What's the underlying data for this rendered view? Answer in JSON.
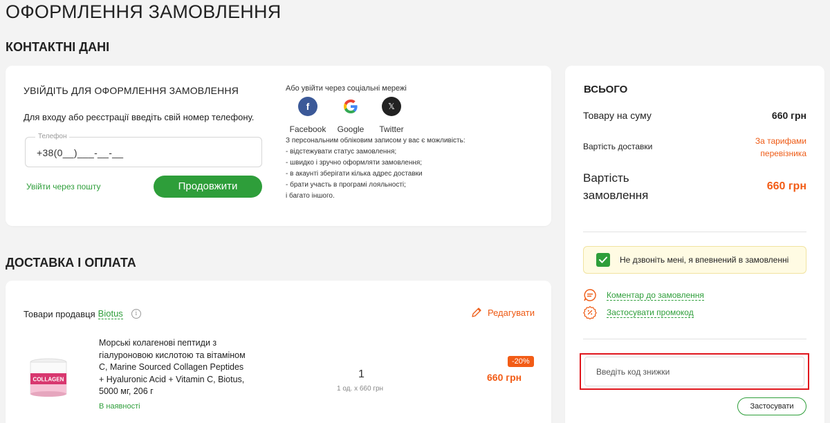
{
  "page": {
    "title": "ОФОРМЛЕННЯ ЗАМОВЛЕННЯ",
    "contacts_title": "КОНТАКТНІ ДАНІ",
    "delivery_title": "ДОСТАВКА І ОПЛАТА"
  },
  "login": {
    "heading": "УВІЙДІТЬ ДЛЯ ОФОРМЛЕННЯ ЗАМОВЛЕННЯ",
    "hint": "Для входу або реєстрації введіть свій номер телефону.",
    "phone_label": "Телефон",
    "phone_value": "+38(0__)___-__-__",
    "email_link": "Увійти через пошту",
    "continue_label": "Продовжити",
    "social_title": "Або увійти через соціальні мережі",
    "social": [
      {
        "name": "Facebook",
        "icon": "facebook-icon"
      },
      {
        "name": "Google",
        "icon": "google-icon"
      },
      {
        "name": "Twitter",
        "icon": "x-icon"
      }
    ],
    "benefits_intro": "З персональним обліковим записом у вас є можливість:",
    "benefits": [
      "- відстежувати статус замовлення;",
      "- швидко і зручно оформляти замовлення;",
      "- в акаунті зберігати кілька адрес доставки",
      "- брати участь в програмі лояльності;",
      "і багато іншого."
    ]
  },
  "goods": {
    "seller_prefix": "Товари продавця",
    "seller_name": "Biotus",
    "edit_label": "Редагувати",
    "item": {
      "name": "Морські колагенові пептиди з гіалуроновою кислотою та вітаміном C, Marine Sourced Collagen Peptides + Hyaluronic Acid + Vitamin C, Biotus, 5000 мг, 206 г",
      "stock": "В наявності",
      "quantity": "1",
      "unit_price": "1 од. х 660 грн",
      "discount": "-20%",
      "price": "660 грн",
      "image_label": "COLLAGEN"
    }
  },
  "summary": {
    "title": "ВСЬОГО",
    "goods_label": "Товару на суму",
    "goods_value": "660 грн",
    "shipping_label": "Вартість доставки",
    "shipping_value_line1": "За тарифами",
    "shipping_value_line2": "перевізника",
    "total_label": "Вартість замовлення",
    "total_value": "660 грн",
    "no_call_label": "Не дзвоніть мені, я впевнений в замовленні",
    "no_call_checked": true,
    "comment_link": "Коментар до замовлення",
    "promo_link": "Застосувати промокод",
    "promo_placeholder": "Введіть код знижки",
    "apply_label": "Застосувати"
  },
  "colors": {
    "accent_green": "#2e9e3a",
    "accent_orange": "#f25c16",
    "highlight_red": "#e0151c"
  }
}
